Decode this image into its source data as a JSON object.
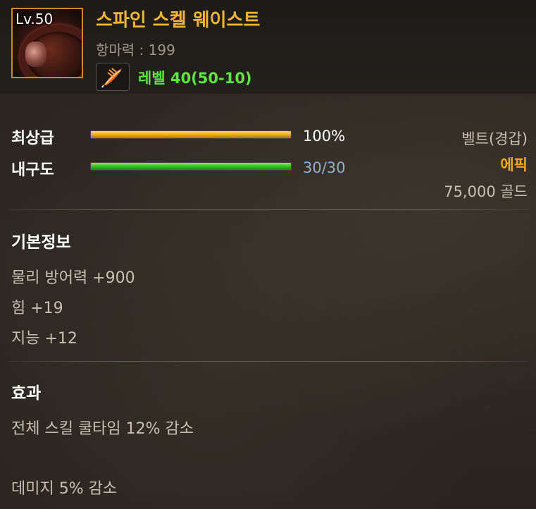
{
  "item": {
    "level_badge": "Lv.50",
    "name": "스파인 스켈 웨이스트",
    "resist": "항마력 : 199",
    "level_requirement": "레벨 40(50-10)",
    "icon": "belt-item-icon",
    "level_icon": "feather-quill-icon"
  },
  "stats": {
    "grade_label": "최상급",
    "grade_value": "100%",
    "grade_fraction": 1.0,
    "durability_label": "내구도",
    "durability_value": "30/30",
    "durability_fraction": 1.0
  },
  "meta": {
    "type": "벨트(경갑)",
    "rarity": "에픽",
    "price": "75,000 골드"
  },
  "basic_info": {
    "title": "기본정보",
    "lines": [
      "물리 방어력 +900",
      "힘 +19",
      "지능 +12"
    ]
  },
  "effects": {
    "title": "효과",
    "lines": [
      "전체 스킬 쿨타임 12% 감소",
      "데미지 5% 감소"
    ]
  },
  "colors": {
    "item_name": "#f2b530",
    "rarity": "#f0a828",
    "level_requirement": "#5ee640",
    "durability_value": "#8fb0d0",
    "grade_bar": "#e8a51e",
    "durability_bar": "#2fbc1e"
  }
}
